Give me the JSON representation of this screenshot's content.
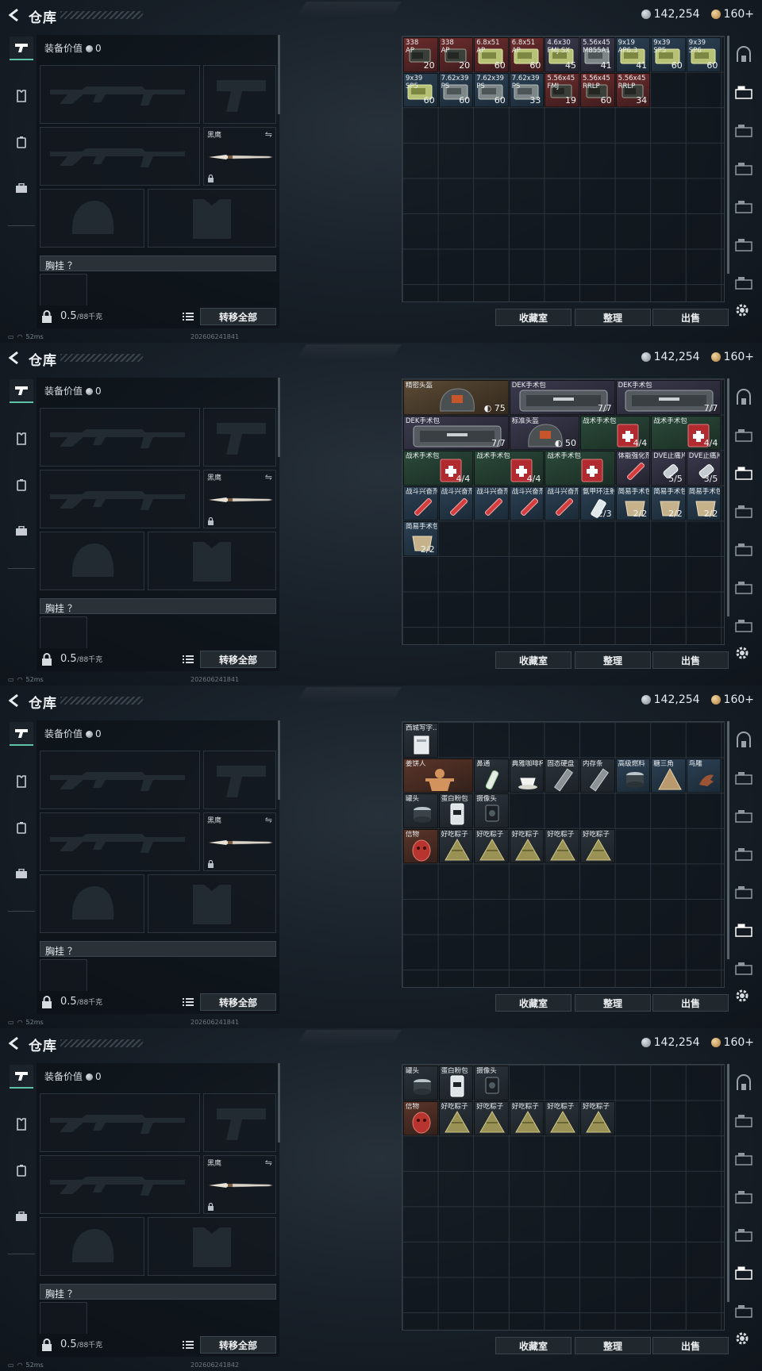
{
  "app": {
    "title": "仓库",
    "currency_silver": "142,254",
    "currency_gold": "160+",
    "status_ping": "52ms"
  },
  "loadout": {
    "equip_value_label": "装备价值",
    "equip_value": "0",
    "knife_name": "黑鹰",
    "chest_rig_label": "胸挂 ？",
    "weight": "0.5",
    "weight_max": "/88千克",
    "transfer_all": "转移全部"
  },
  "buttons": {
    "collection": "收藏室",
    "sort": "整理",
    "sell": "出售"
  },
  "screens": [
    {
      "timestamp": "202606241841",
      "items": [
        {
          "n": "338",
          "n2": "AP",
          "c": "20",
          "x": 0,
          "y": 0,
          "w": 1,
          "h": 1,
          "bg": "bgred",
          "pic": "ammo-red"
        },
        {
          "n": "338",
          "n2": "AP",
          "c": "20",
          "x": 1,
          "y": 0,
          "w": 1,
          "h": 1,
          "bg": "bgred",
          "pic": "ammo-red"
        },
        {
          "n": "6.8x51",
          "n2": "AP",
          "c": "60",
          "x": 2,
          "y": 0,
          "w": 1,
          "h": 1,
          "bg": "bgred",
          "pic": "ammo-green"
        },
        {
          "n": "6.8x51",
          "n2": "AP",
          "c": "60",
          "x": 3,
          "y": 0,
          "w": 1,
          "h": 1,
          "bg": "bgred",
          "pic": "ammo-green"
        },
        {
          "n": "4.6x30",
          "n2": "FMJ SX",
          "c": "45",
          "x": 4,
          "y": 0,
          "w": 1,
          "h": 1,
          "bg": "bgpurple",
          "pic": "ammo-green"
        },
        {
          "n": "5.56x45",
          "n2": "M855A1",
          "c": "41",
          "x": 5,
          "y": 0,
          "w": 1,
          "h": 1,
          "bg": "bgpurple",
          "pic": "ammo-gray"
        },
        {
          "n": "9x19",
          "n2": "AP6.3",
          "c": "41",
          "x": 6,
          "y": 0,
          "w": 1,
          "h": 1,
          "bg": "bgblue",
          "pic": "ammo-green"
        },
        {
          "n": "9x39",
          "n2": "SP5",
          "c": "60",
          "x": 7,
          "y": 0,
          "w": 1,
          "h": 1,
          "bg": "bgblue",
          "pic": "ammo-green"
        },
        {
          "n": "9x39",
          "n2": "SP6",
          "c": "60",
          "x": 8,
          "y": 0,
          "w": 1,
          "h": 1,
          "bg": "bgblue",
          "pic": "ammo-green"
        },
        {
          "n": "9x39",
          "n2": "SP5",
          "c": "60",
          "x": 0,
          "y": 1,
          "w": 1,
          "h": 1,
          "bg": "bgblue",
          "pic": "ammo-green"
        },
        {
          "n": "7.62x39",
          "n2": "PS",
          "c": "60",
          "x": 1,
          "y": 1,
          "w": 1,
          "h": 1,
          "bg": "bgblue",
          "pic": "ammo-gray"
        },
        {
          "n": "7.62x39",
          "n2": "PS",
          "c": "60",
          "x": 2,
          "y": 1,
          "w": 1,
          "h": 1,
          "bg": "bgblue",
          "pic": "ammo-gray"
        },
        {
          "n": "7.62x39",
          "n2": "PS",
          "c": "33",
          "x": 3,
          "y": 1,
          "w": 1,
          "h": 1,
          "bg": "bgblue",
          "pic": "ammo-gray"
        },
        {
          "n": "5.56x45",
          "n2": "FMJ",
          "c": "19",
          "x": 4,
          "y": 1,
          "w": 1,
          "h": 1,
          "bg": "bgred",
          "pic": "ammo-red"
        },
        {
          "n": "5.56x45",
          "n2": "RRLP",
          "c": "60",
          "x": 5,
          "y": 1,
          "w": 1,
          "h": 1,
          "bg": "bgred",
          "pic": "ammo-red"
        },
        {
          "n": "5.56x45",
          "n2": "RRLP",
          "c": "34",
          "x": 6,
          "y": 1,
          "w": 1,
          "h": 1,
          "bg": "bgred",
          "pic": "ammo-red"
        }
      ]
    },
    {
      "timestamp": "202606241841",
      "items": [
        {
          "n": "精密头盔",
          "c": "75",
          "x": 0,
          "y": 0,
          "w": 3,
          "h": 1,
          "bg": "bggold",
          "pic": "helmet",
          "shield": true
        },
        {
          "n": "DEK手术包",
          "c": "7/7",
          "x": 3,
          "y": 0,
          "w": 3,
          "h": 1,
          "bg": "bgpurple",
          "pic": "case"
        },
        {
          "n": "DEK手术包",
          "c": "7/7",
          "x": 6,
          "y": 0,
          "w": 3,
          "h": 1,
          "bg": "bgpurple",
          "pic": "case"
        },
        {
          "n": "DEK手术包",
          "c": "7/7",
          "x": 0,
          "y": 1,
          "w": 3,
          "h": 1,
          "bg": "bgpurple",
          "pic": "case"
        },
        {
          "n": "标准头盔",
          "c": "50",
          "x": 3,
          "y": 1,
          "w": 2,
          "h": 1,
          "bg": "bgpurple",
          "pic": "helmet",
          "shield": true
        },
        {
          "n": "战术手术包",
          "c": "4/4",
          "x": 5,
          "y": 1,
          "w": 2,
          "h": 1,
          "bg": "bggreen",
          "pic": "medkit"
        },
        {
          "n": "战术手术包",
          "c": "4/4",
          "x": 7,
          "y": 1,
          "w": 2,
          "h": 1,
          "bg": "bggreen",
          "pic": "medkit"
        },
        {
          "n": "战术手术包",
          "c": "4/4",
          "x": 0,
          "y": 2,
          "w": 2,
          "h": 1,
          "bg": "bggreen",
          "pic": "medkit"
        },
        {
          "n": "战术手术包",
          "c": "4/4",
          "x": 2,
          "y": 2,
          "w": 2,
          "h": 1,
          "bg": "bggreen",
          "pic": "medkit"
        },
        {
          "n": "战术手术包",
          "c": "",
          "x": 4,
          "y": 2,
          "w": 2,
          "h": 1,
          "bg": "bggreen",
          "pic": "medkit"
        },
        {
          "n": "体能强化剂",
          "c": "",
          "x": 6,
          "y": 2,
          "w": 1,
          "h": 1,
          "bg": "bgpurple",
          "pic": "syringe"
        },
        {
          "n": "DVE止痛片",
          "c": "5/5",
          "x": 7,
          "y": 2,
          "w": 1,
          "h": 1,
          "bg": "bgpurple",
          "pic": "pill"
        },
        {
          "n": "DVE止痛片",
          "c": "3/5",
          "x": 8,
          "y": 2,
          "w": 1,
          "h": 1,
          "bg": "bgpurple",
          "pic": "pill"
        },
        {
          "n": "战斗兴奋剂",
          "c": "",
          "x": 0,
          "y": 3,
          "w": 1,
          "h": 1,
          "bg": "bgblue",
          "pic": "syringe"
        },
        {
          "n": "战斗兴奋剂",
          "c": "",
          "x": 1,
          "y": 3,
          "w": 1,
          "h": 1,
          "bg": "bgblue",
          "pic": "syringe"
        },
        {
          "n": "战斗兴奋剂",
          "c": "",
          "x": 2,
          "y": 3,
          "w": 1,
          "h": 1,
          "bg": "bgblue",
          "pic": "syringe"
        },
        {
          "n": "战斗兴奋剂",
          "c": "",
          "x": 3,
          "y": 3,
          "w": 1,
          "h": 1,
          "bg": "bgblue",
          "pic": "syringe"
        },
        {
          "n": "战斗兴奋剂",
          "c": "",
          "x": 4,
          "y": 3,
          "w": 1,
          "h": 1,
          "bg": "bgblue",
          "pic": "syringe"
        },
        {
          "n": "氨甲环注射",
          "c": "2/3",
          "x": 5,
          "y": 3,
          "w": 1,
          "h": 1,
          "bg": "bgblue",
          "pic": "vial"
        },
        {
          "n": "简易手术包",
          "c": "2/2",
          "x": 6,
          "y": 3,
          "w": 1,
          "h": 1,
          "bg": "bgblue",
          "pic": "pouch"
        },
        {
          "n": "简易手术包",
          "c": "2/2",
          "x": 7,
          "y": 3,
          "w": 1,
          "h": 1,
          "bg": "bgblue",
          "pic": "pouch"
        },
        {
          "n": "简易手术包",
          "c": "2/2",
          "x": 8,
          "y": 3,
          "w": 1,
          "h": 1,
          "bg": "bgblue",
          "pic": "pouch"
        },
        {
          "n": "简易手术包",
          "c": "2/2",
          "x": 0,
          "y": 4,
          "w": 1,
          "h": 1,
          "bg": "bgblue",
          "pic": "pouch"
        }
      ]
    },
    {
      "timestamp": "202606241841",
      "items": [
        {
          "n": "西城写字...",
          "c": "",
          "x": 0,
          "y": 0,
          "w": 1,
          "h": 1,
          "bg": "bggray",
          "pic": "card"
        },
        {
          "n": "姜饼人",
          "c": "",
          "x": 0,
          "y": 1,
          "w": 2,
          "h": 1,
          "bg": "bgbrown",
          "pic": "ginger"
        },
        {
          "n": "鼻通",
          "c": "",
          "x": 2,
          "y": 1,
          "w": 1,
          "h": 1,
          "bg": "bggray",
          "pic": "tube"
        },
        {
          "n": "典雅咖啡杯",
          "c": "",
          "x": 3,
          "y": 1,
          "w": 1,
          "h": 1,
          "bg": "bggray",
          "pic": "cup"
        },
        {
          "n": "固态硬盘",
          "c": "",
          "x": 4,
          "y": 1,
          "w": 1,
          "h": 1,
          "bg": "bggray",
          "pic": "ssd"
        },
        {
          "n": "内存条",
          "c": "",
          "x": 5,
          "y": 1,
          "w": 1,
          "h": 1,
          "bg": "bggray",
          "pic": "ssd"
        },
        {
          "n": "高级燃料",
          "c": "",
          "x": 6,
          "y": 1,
          "w": 1,
          "h": 1,
          "bg": "bgblue",
          "pic": "can"
        },
        {
          "n": "糖三角",
          "c": "",
          "x": 7,
          "y": 1,
          "w": 1,
          "h": 1,
          "bg": "bgblue",
          "pic": "triangle"
        },
        {
          "n": "鸟雕",
          "c": "",
          "x": 8,
          "y": 1,
          "w": 1,
          "h": 1,
          "bg": "bgblue",
          "pic": "bird"
        },
        {
          "n": "罐头",
          "c": "",
          "x": 0,
          "y": 2,
          "w": 1,
          "h": 1,
          "bg": "bggray",
          "pic": "can"
        },
        {
          "n": "蛋白粉包",
          "c": "",
          "x": 1,
          "y": 2,
          "w": 1,
          "h": 1,
          "bg": "bggray",
          "pic": "bag"
        },
        {
          "n": "摄像头",
          "c": "",
          "x": 2,
          "y": 2,
          "w": 1,
          "h": 1,
          "bg": "bggray",
          "pic": "camera"
        },
        {
          "n": "信物",
          "c": "",
          "x": 0,
          "y": 3,
          "w": 1,
          "h": 1,
          "bg": "bgbrown",
          "pic": "mask"
        },
        {
          "n": "好吃粽子",
          "c": "",
          "x": 1,
          "y": 3,
          "w": 1,
          "h": 1,
          "bg": "bggray",
          "pic": "zongzi"
        },
        {
          "n": "好吃粽子",
          "c": "",
          "x": 2,
          "y": 3,
          "w": 1,
          "h": 1,
          "bg": "bggray",
          "pic": "zongzi"
        },
        {
          "n": "好吃粽子",
          "c": "",
          "x": 3,
          "y": 3,
          "w": 1,
          "h": 1,
          "bg": "bggray",
          "pic": "zongzi"
        },
        {
          "n": "好吃粽子",
          "c": "",
          "x": 4,
          "y": 3,
          "w": 1,
          "h": 1,
          "bg": "bggray",
          "pic": "zongzi"
        },
        {
          "n": "好吃粽子",
          "c": "",
          "x": 5,
          "y": 3,
          "w": 1,
          "h": 1,
          "bg": "bggray",
          "pic": "zongzi"
        }
      ]
    },
    {
      "timestamp": "202606241842",
      "items": [
        {
          "n": "罐头",
          "c": "",
          "x": 0,
          "y": 0,
          "w": 1,
          "h": 1,
          "bg": "bggray",
          "pic": "can"
        },
        {
          "n": "蛋白粉包",
          "c": "",
          "x": 1,
          "y": 0,
          "w": 1,
          "h": 1,
          "bg": "bggray",
          "pic": "bag"
        },
        {
          "n": "摄像头",
          "c": "",
          "x": 2,
          "y": 0,
          "w": 1,
          "h": 1,
          "bg": "bggray",
          "pic": "camera"
        },
        {
          "n": "信物",
          "c": "",
          "x": 0,
          "y": 1,
          "w": 1,
          "h": 1,
          "bg": "bgbrown",
          "pic": "mask"
        },
        {
          "n": "好吃粽子",
          "c": "",
          "x": 1,
          "y": 1,
          "w": 1,
          "h": 1,
          "bg": "bggray",
          "pic": "zongzi"
        },
        {
          "n": "好吃粽子",
          "c": "",
          "x": 2,
          "y": 1,
          "w": 1,
          "h": 1,
          "bg": "bggray",
          "pic": "zongzi"
        },
        {
          "n": "好吃粽子",
          "c": "",
          "x": 3,
          "y": 1,
          "w": 1,
          "h": 1,
          "bg": "bggray",
          "pic": "zongzi"
        },
        {
          "n": "好吃粽子",
          "c": "",
          "x": 4,
          "y": 1,
          "w": 1,
          "h": 1,
          "bg": "bggray",
          "pic": "zongzi"
        },
        {
          "n": "好吃粽子",
          "c": "",
          "x": 5,
          "y": 1,
          "w": 1,
          "h": 1,
          "bg": "bggray",
          "pic": "zongzi"
        }
      ]
    }
  ],
  "active_right_tab": [
    "tab-ammo",
    "tab-medical",
    "tab-collectibles",
    "tab-collectibles"
  ]
}
